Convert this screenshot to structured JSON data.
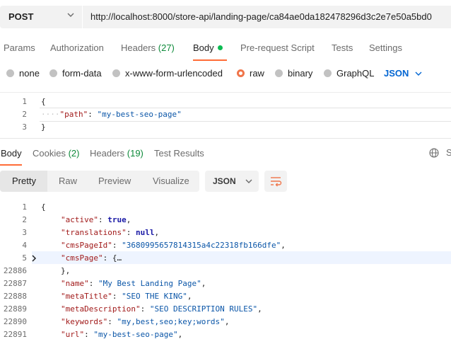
{
  "request": {
    "method": "POST",
    "url": "http://localhost:8000/store-api/landing-page/ca84ae0da182478296d3c2e7e50a5bd0"
  },
  "request_tabs": {
    "params": "Params",
    "authorization": "Authorization",
    "headers": "Headers",
    "headers_count": "(27)",
    "body": "Body",
    "pre_request": "Pre-request Script",
    "tests": "Tests",
    "settings": "Settings"
  },
  "body_types": {
    "none": "none",
    "form_data": "form-data",
    "urlencoded": "x-www-form-urlencoded",
    "raw": "raw",
    "binary": "binary",
    "graphql": "GraphQL",
    "raw_format": "JSON"
  },
  "request_body": [
    {
      "ln": "1",
      "text": "{"
    },
    {
      "ln": "2",
      "key": "\"path\"",
      "value": "\"my-best-seo-page\""
    },
    {
      "ln": "3",
      "text": "}"
    }
  ],
  "response_tabs": {
    "body": "Body",
    "cookies": "Cookies",
    "cookies_count": "(2)",
    "headers": "Headers",
    "headers_count": "(19)",
    "test_results": "Test Results",
    "save_cut": "S"
  },
  "view_modes": {
    "pretty": "Pretty",
    "raw": "Raw",
    "preview": "Preview",
    "visualize": "Visualize",
    "format": "JSON"
  },
  "response_body": {
    "l1": {
      "ln": "1",
      "text": "{"
    },
    "l2": {
      "ln": "2",
      "key": "\"active\"",
      "value": "true"
    },
    "l3": {
      "ln": "3",
      "key": "\"translations\"",
      "value": "null"
    },
    "l4": {
      "ln": "4",
      "key": "\"cmsPageId\"",
      "value": "\"3680995657814315a4c22318fb166dfe\""
    },
    "l5": {
      "ln": "5",
      "key": "\"cmsPage\"",
      "value": "{…"
    },
    "l6": {
      "ln": "22886",
      "text": "},"
    },
    "l7": {
      "ln": "22887",
      "key": "\"name\"",
      "value": "\"My Best Landing Page\""
    },
    "l8": {
      "ln": "22888",
      "key": "\"metaTitle\"",
      "value": "\"SEO THE KING\""
    },
    "l9": {
      "ln": "22889",
      "key": "\"metaDescription\"",
      "value": "\"SEO DESCRIPTION RULES\""
    },
    "l10": {
      "ln": "22890",
      "key": "\"keywords\"",
      "value": "\"my,best,seo;key;words\""
    },
    "l11": {
      "ln": "22891",
      "key": "\"url\"",
      "value": "\"my-best-seo-page\""
    }
  },
  "colors": {
    "accent": "#ff6c37",
    "json_blue": "#0265d2",
    "count_green": "#0e8a3a",
    "json_key": "#a11a1a",
    "json_string": "#0b56a8"
  }
}
